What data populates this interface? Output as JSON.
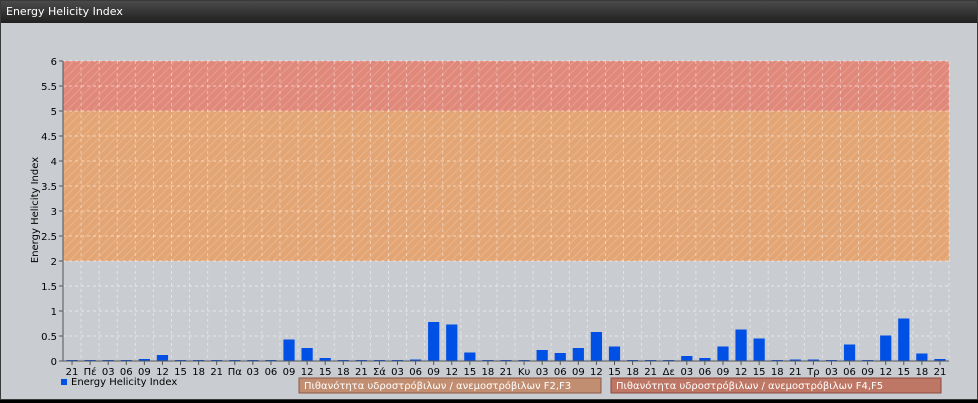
{
  "window": {
    "title": "Energy Helicity Index"
  },
  "chart_data": {
    "type": "bar",
    "ylabel": "Energy Helicity Index",
    "ylim": [
      0,
      6
    ],
    "yticks": [
      "0",
      "0.5",
      "1",
      "1.5",
      "2",
      "2.5",
      "3",
      "3.5",
      "4",
      "4.5",
      "5",
      "5.5",
      "6"
    ],
    "categories": [
      "21",
      "Πέ",
      "03",
      "06",
      "09",
      "12",
      "15",
      "18",
      "21",
      "Πα",
      "03",
      "06",
      "09",
      "12",
      "15",
      "18",
      "21",
      "Σά",
      "03",
      "06",
      "09",
      "12",
      "15",
      "18",
      "21",
      "Κυ",
      "03",
      "06",
      "09",
      "12",
      "15",
      "18",
      "21",
      "Δε",
      "03",
      "06",
      "09",
      "12",
      "15",
      "18",
      "21",
      "Τρ",
      "03",
      "06",
      "09",
      "12",
      "15",
      "18",
      "21"
    ],
    "series": [
      {
        "name": "Energy Helicity Index",
        "color": "#0050e6",
        "values": [
          0.02,
          0.02,
          0.02,
          0.02,
          0.04,
          0.12,
          0.02,
          0.02,
          0.02,
          0.02,
          0.02,
          0.02,
          0.43,
          0.26,
          0.06,
          0.02,
          0.02,
          0.02,
          0.02,
          0.03,
          0.78,
          0.73,
          0.17,
          0.02,
          0.02,
          0.02,
          0.22,
          0.16,
          0.26,
          0.58,
          0.29,
          0.02,
          0.02,
          0.02,
          0.1,
          0.06,
          0.29,
          0.63,
          0.45,
          0.02,
          0.03,
          0.03,
          0.02,
          0.33,
          0.02,
          0.51,
          0.85,
          0.15,
          0.04
        ]
      }
    ],
    "bands": [
      {
        "from": 2,
        "to": 5,
        "color": "#e3a574"
      },
      {
        "from": 5,
        "to": 6,
        "color": "#e0887a"
      }
    ],
    "grid": true,
    "legend": {
      "series_label": "Energy Helicity Index",
      "band_labels": [
        "Πιθανότητα υδροστρόβιλων / ανεμοστρόβιλων F2,F3",
        "Πιθανότητα υδροστρόβιλων / ανεμοστρόβιλων F4,F5"
      ],
      "band_colors": [
        "#c28e72",
        "#bf7765"
      ]
    }
  }
}
